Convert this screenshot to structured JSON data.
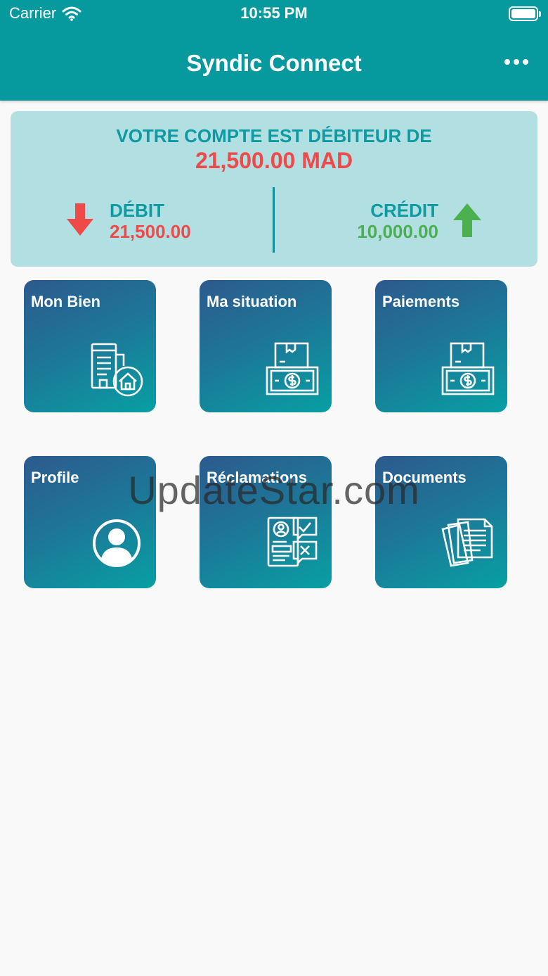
{
  "status_bar": {
    "carrier": "Carrier",
    "time": "10:55 PM"
  },
  "header": {
    "title": "Syndic Connect"
  },
  "balance": {
    "heading": "VOTRE COMPTE EST DÉBITEUR DE",
    "amount": "21,500.00 MAD",
    "debit_label": "DÉBIT",
    "debit_value": "21,500.00",
    "credit_label": "CRÉDIT",
    "credit_value": "10,000.00"
  },
  "tiles": [
    {
      "label": "Mon Bien",
      "icon": "building-house-icon"
    },
    {
      "label": "Ma situation",
      "icon": "money-box-icon"
    },
    {
      "label": "Paiements",
      "icon": "money-box-icon"
    },
    {
      "label": "Profile",
      "icon": "user-circle-icon"
    },
    {
      "label": "Réclamations",
      "icon": "complaint-form-icon"
    },
    {
      "label": "Documents",
      "icon": "documents-icon"
    }
  ],
  "watermark": "UpdateStar.com",
  "colors": {
    "primary": "#069a9e",
    "card": "#b2dfe2",
    "debit": "#ee4a4a",
    "credit": "#4caf50"
  }
}
